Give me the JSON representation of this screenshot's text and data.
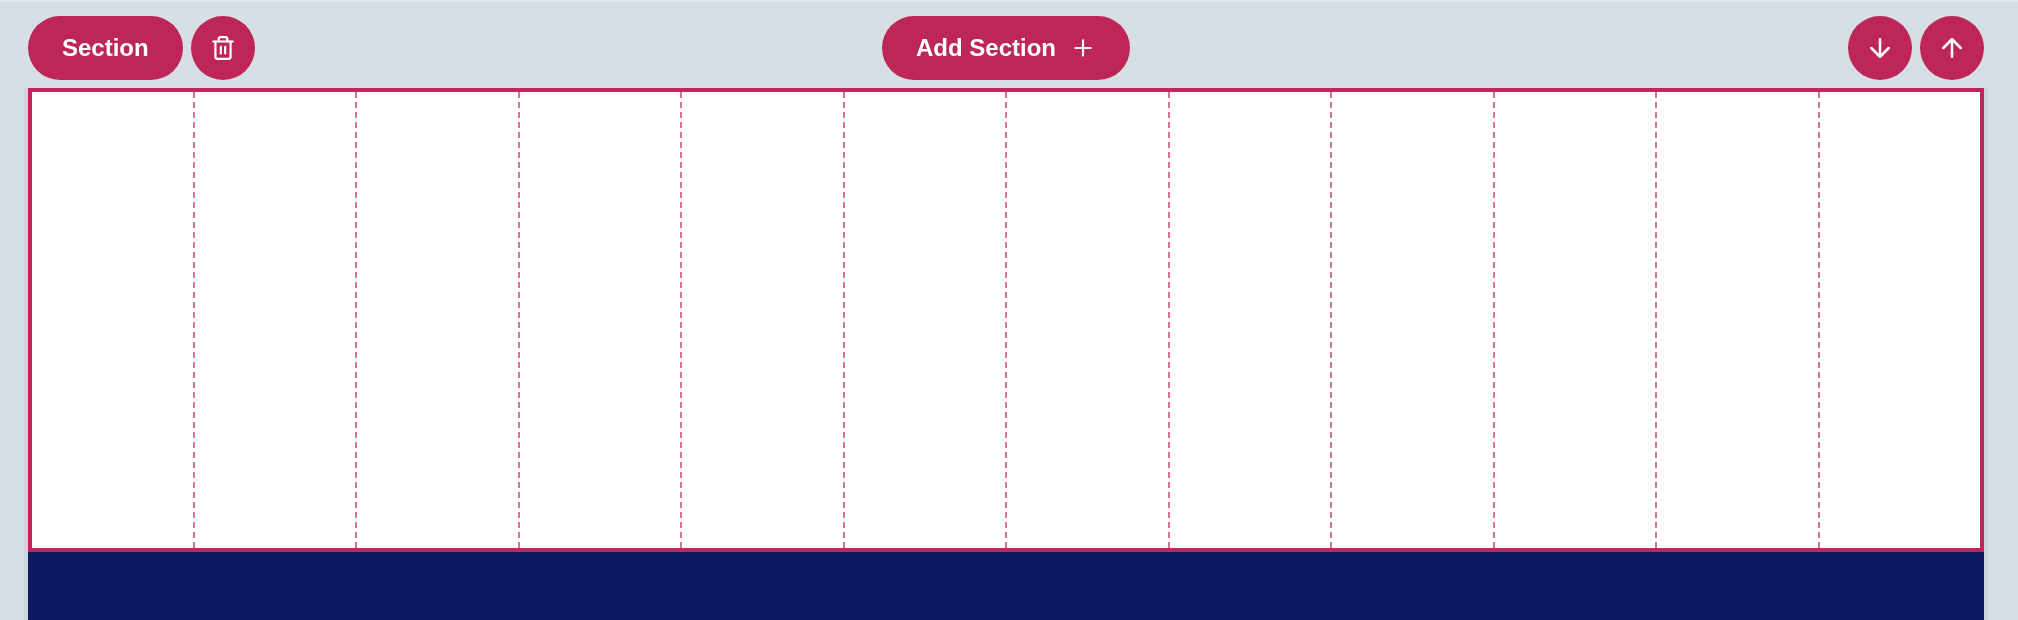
{
  "toolbar": {
    "section_button": "Section",
    "add_section_button": "Add Section"
  }
}
